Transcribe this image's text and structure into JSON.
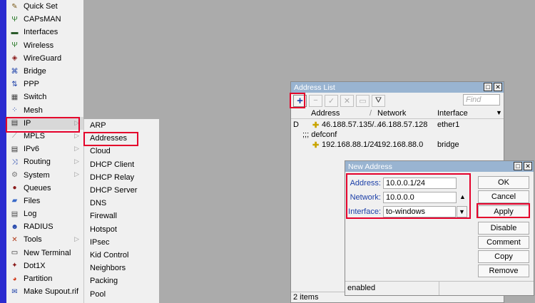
{
  "main_menu": [
    {
      "icon": "wand-icon",
      "label": "Quick Set"
    },
    {
      "icon": "antenna-icon",
      "label": "CAPsMAN"
    },
    {
      "icon": "interfaces-icon",
      "label": "Interfaces"
    },
    {
      "icon": "wireless-icon",
      "label": "Wireless"
    },
    {
      "icon": "wireguard-icon",
      "label": "WireGuard"
    },
    {
      "icon": "bridge-icon",
      "label": "Bridge"
    },
    {
      "icon": "ppp-icon",
      "label": "PPP"
    },
    {
      "icon": "switch-icon",
      "label": "Switch"
    },
    {
      "icon": "mesh-icon",
      "label": "Mesh"
    },
    {
      "icon": "ip-icon",
      "label": "IP"
    },
    {
      "icon": "mpls-icon",
      "label": "MPLS"
    },
    {
      "icon": "ipv6-icon",
      "label": "IPv6"
    },
    {
      "icon": "routing-icon",
      "label": "Routing"
    },
    {
      "icon": "system-icon",
      "label": "System"
    },
    {
      "icon": "queues-icon",
      "label": "Queues"
    },
    {
      "icon": "folder-icon",
      "label": "Files"
    },
    {
      "icon": "log-icon",
      "label": "Log"
    },
    {
      "icon": "radius-icon",
      "label": "RADIUS"
    },
    {
      "icon": "tools-icon",
      "label": "Tools"
    },
    {
      "icon": "terminal-icon",
      "label": "New Terminal"
    },
    {
      "icon": "dot1x-icon",
      "label": "Dot1X"
    },
    {
      "icon": "partition-icon",
      "label": "Partition"
    },
    {
      "icon": "supout-icon",
      "label": "Make Supout.rif"
    }
  ],
  "ip_submenu": [
    "ARP",
    "Addresses",
    "Cloud",
    "DHCP Client",
    "DHCP Relay",
    "DHCP Server",
    "DNS",
    "Firewall",
    "Hotspot",
    "IPsec",
    "Kid Control",
    "Neighbors",
    "Packing",
    "Pool"
  ],
  "address_list": {
    "title": "Address List",
    "find_placeholder": "Find",
    "columns": {
      "address": "Address",
      "network": "Network",
      "interface": "Interface"
    },
    "rows": [
      {
        "flag": "D",
        "address": "46.188.57.135/...",
        "network": "46.188.57.128",
        "interface": "ether1"
      },
      {
        "comment": ";;; defconf"
      },
      {
        "flag": "",
        "address": "192.168.88.1/24",
        "network": "192.168.88.0",
        "interface": "bridge"
      }
    ],
    "status": "2 items"
  },
  "new_address": {
    "title": "New Address",
    "address_label": "Address:",
    "address_value": "10.0.0.1/24",
    "network_label": "Network:",
    "network_value": "10.0.0.0",
    "interface_label": "Interface:",
    "interface_value": "to-windows",
    "buttons": {
      "ok": "OK",
      "cancel": "Cancel",
      "apply": "Apply",
      "disable": "Disable",
      "comment": "Comment",
      "copy": "Copy",
      "remove": "Remove"
    },
    "status": "enabled"
  },
  "colors": {
    "highlight": "#e4002b",
    "titlebar": "#99b4d1",
    "sidebar_strip": "#2b2bd0",
    "label_blue": "#1b3fa8"
  }
}
